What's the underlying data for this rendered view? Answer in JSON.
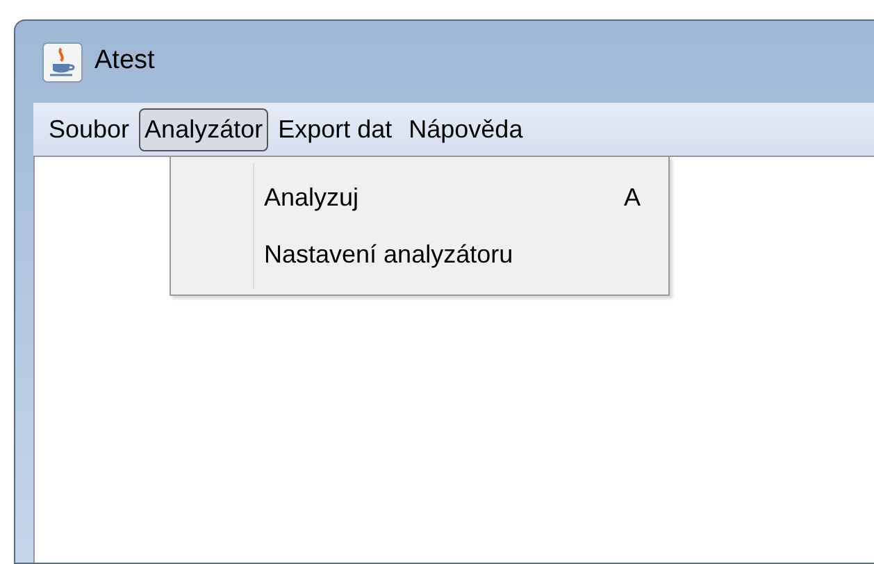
{
  "window": {
    "title": "Atest"
  },
  "menu_bar": [
    {
      "label": "Soubor",
      "selected": false
    },
    {
      "label": "Analyzátor",
      "selected": true
    },
    {
      "label": "Export dat",
      "selected": false
    },
    {
      "label": "Nápověda",
      "selected": false
    }
  ],
  "dropdown": [
    {
      "label": "Analyzuj",
      "shortcut": "A"
    },
    {
      "label": "Nastavení analyzátoru"
    }
  ]
}
